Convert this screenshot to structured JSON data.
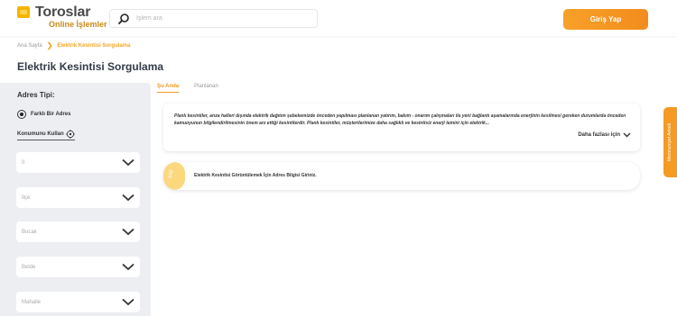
{
  "header": {
    "logo_title": "Toroslar",
    "logo_subtitle": "Online İşlemler",
    "search_placeholder": "İşlem ara",
    "login_label": "Giriş Yap"
  },
  "breadcrumb": {
    "home": "Ana Sayfa",
    "separator": "❯",
    "current": "Elektrik Kesintisi Sorgulama"
  },
  "page_title": "Elektrik Kesintisi Sorgulama",
  "sidebar": {
    "address_type_label": "Adres Tipi:",
    "radio_label": "Farklı Bir Adres",
    "locate_label": "Konumunu Kullan",
    "selects": [
      {
        "label": "İl"
      },
      {
        "label": "İlçe"
      },
      {
        "label": "Bucak"
      },
      {
        "label": "Belde"
      },
      {
        "label": "Mahalle"
      }
    ]
  },
  "tabs": [
    {
      "label": "Şu Anda",
      "active": true
    },
    {
      "label": "Planlanan",
      "active": false
    }
  ],
  "info": {
    "text": "Planlı kesintiler, arıza halleri dışında elektrik dağıtım şebekemizde önceden yapılması planlanan yatırım, bakım - onarım çalışmaları ile yeni bağlantı aşamalarında enerjinin kesilmesi gereken durumlarda önceden kamuoyunun bilgilendirilmesinin önem arz ettiği kesintilerdir. Planlı kesintiler, müşterilerimize daha sağlıklı ve kesintisiz enerji temini için elektrik...",
    "more_label": "Daha fazlası için"
  },
  "notice": {
    "accent_text": "Bilgi",
    "text": "Elektrik Kesintisi Görüntülemek İçin Adres Bilgisi Giriniz."
  },
  "side_tab": {
    "label": "Memnuniyet Anketi"
  },
  "colors": {
    "accent": "#f59a23",
    "logo": "#f5b400",
    "sidebar_bg": "#eceef2",
    "title": "#333b4a"
  }
}
